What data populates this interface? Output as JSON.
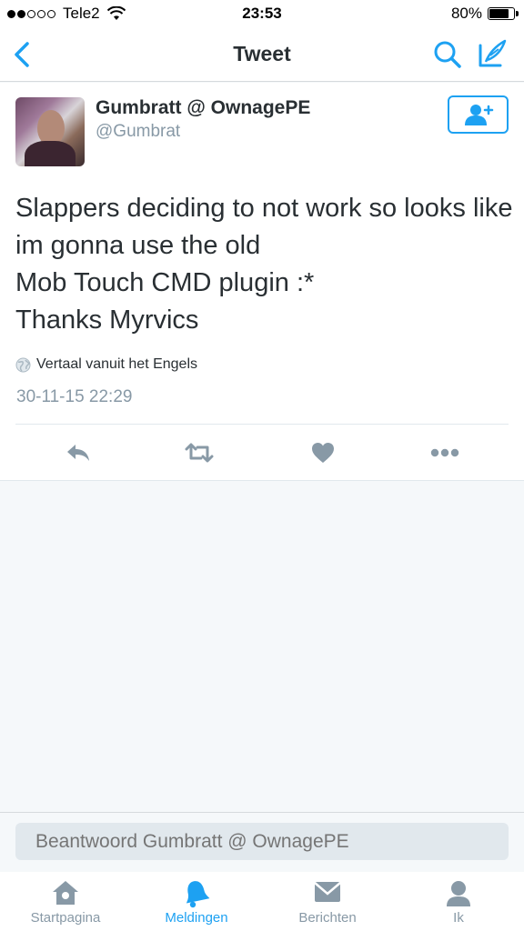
{
  "status_bar": {
    "carrier": "Tele2",
    "time": "23:53",
    "battery_percent": "80%",
    "battery_level": 0.8,
    "signal_bars_filled": 2,
    "signal_bars_total": 5
  },
  "nav": {
    "title": "Tweet",
    "back_icon": "chevron-left-icon",
    "search_icon": "search-icon",
    "compose_icon": "compose-tweet-icon"
  },
  "tweet": {
    "display_name": "Gumbratt @ OwnagePE",
    "handle": "@Gumbrat",
    "text_lines": [
      "Slappers deciding to not work so looks like",
      "im gonna use the old",
      "Mob Touch CMD plugin :*",
      "Thanks Myrvics"
    ],
    "translate_label": "Vertaal vanuit het Engels",
    "timestamp": "30-11-15 22:29"
  },
  "reply": {
    "placeholder": "Beantwoord Gumbratt @ OwnagePE"
  },
  "tabs": [
    {
      "label": "Startpagina",
      "icon": "home-icon",
      "active": false
    },
    {
      "label": "Meldingen",
      "icon": "bell-icon",
      "active": true
    },
    {
      "label": "Berichten",
      "icon": "envelope-icon",
      "active": false
    },
    {
      "label": "Ik",
      "icon": "person-icon",
      "active": false
    }
  ],
  "colors": {
    "accent": "#1da1f2",
    "muted": "#8899a6",
    "icon_gray": "#8899a6",
    "text": "#292f33"
  }
}
